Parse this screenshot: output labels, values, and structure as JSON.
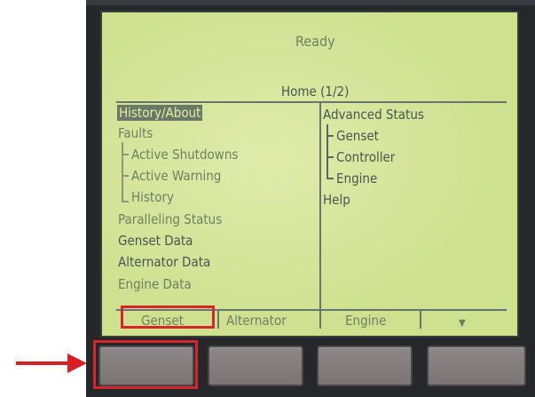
{
  "screen": {
    "status": "Ready",
    "title": "Home (1/2)"
  },
  "menu_left": [
    {
      "label": "History/About",
      "selected": true
    },
    {
      "label": "Faults"
    },
    {
      "label": "Active Shutdowns"
    },
    {
      "label": "Active Warning"
    },
    {
      "label": "History"
    },
    {
      "label": "Paralleling Status"
    },
    {
      "label": "Genset Data"
    },
    {
      "label": "Alternator Data"
    },
    {
      "label": "Engine Data"
    }
  ],
  "menu_right": [
    {
      "label": "Advanced Status"
    },
    {
      "label": "Genset"
    },
    {
      "label": "Controller"
    },
    {
      "label": "Engine"
    },
    {
      "label": "Help"
    }
  ],
  "softkeys": [
    {
      "label": "Genset",
      "selected": true
    },
    {
      "label": "Alternator"
    },
    {
      "label": "Engine"
    },
    {
      "label": "▼"
    }
  ],
  "colors": {
    "lcd_background": "#cfe08f",
    "lcd_text_dark": "#4a5552",
    "lcd_text_light": "#6f7f62",
    "highlight_box": "#d5262b",
    "bezel": "#26272b",
    "button": "#857f80"
  }
}
